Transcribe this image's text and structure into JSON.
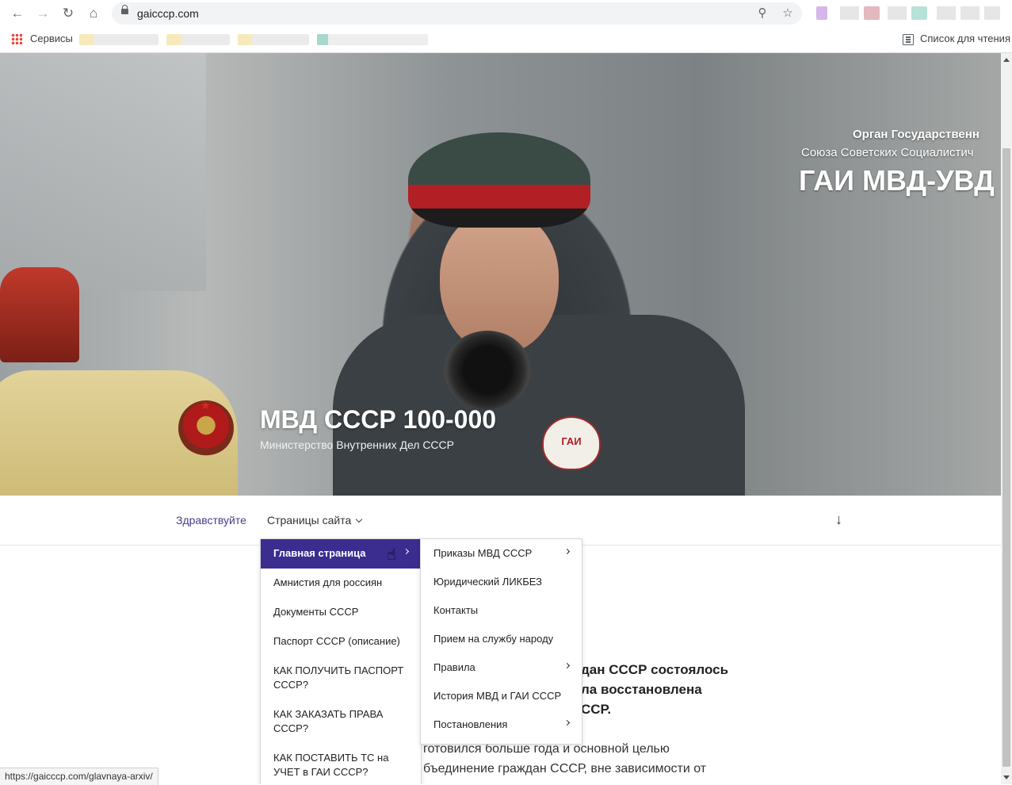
{
  "browser": {
    "url": "gaicccp.com",
    "bookmarks_apps_label": "Сервисы",
    "reading_list_label": "Список для чтения",
    "status_url": "https://gaicccp.com/glavnaya-arxiv/"
  },
  "hero": {
    "overlay_line1": "Орган Государственн",
    "overlay_line2": "Союза Советских Социалистич",
    "overlay_line3": "ГАИ МВД-УВД",
    "badge_text": "ГАИ",
    "site_title": "МВД СССР 100-000",
    "site_subtitle": "Министерство Внутренних Дел СССР"
  },
  "nav": {
    "hello": "Здравствуйте",
    "pages": "Страницы сайта"
  },
  "menu_primary": [
    {
      "label": "Главная страница",
      "active": true,
      "has_sub": true
    },
    {
      "label": "Амнистия для россиян"
    },
    {
      "label": "Документы СССР"
    },
    {
      "label": "Паспорт СССР (описание)"
    },
    {
      "label": "КАК ПОЛУЧИТЬ ПАСПОРТ СССР?"
    },
    {
      "label": "КАК ЗАКАЗАТЬ ПРАВА СССР?"
    },
    {
      "label": "КАК ПОСТАВИТЬ ТС на УЧЕТ в ГАИ СССР?"
    }
  ],
  "menu_secondary": [
    {
      "label": "Приказы МВД СССР",
      "has_sub": true
    },
    {
      "label": "Юридический ЛИКБЕЗ"
    },
    {
      "label": "Контакты"
    },
    {
      "label": "Прием на службу народу"
    },
    {
      "label": "Правила",
      "has_sub": true
    },
    {
      "label": "История МВД и ГАИ СССР"
    },
    {
      "label": "Постановления",
      "has_sub": true
    }
  ],
  "article": {
    "bold_line1": "дан СССР состоялось",
    "bold_line2": "ла восстановлена",
    "bold_line3": "ССР.",
    "para_line1": "готовился больше года и основной целью",
    "para_line2": "бъединение граждан СССР, вне зависимости от"
  },
  "colors": {
    "accent": "#3a2d8f",
    "nav_link": "#4a3c8c"
  }
}
